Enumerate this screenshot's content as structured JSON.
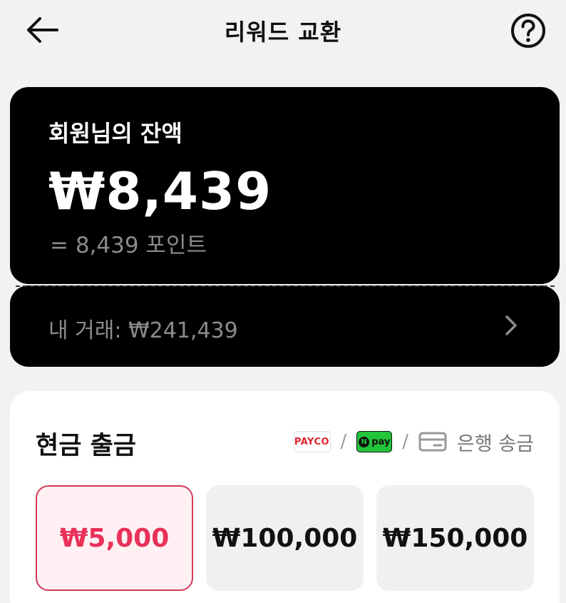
{
  "header": {
    "back_icon": "arrow-left-icon",
    "title": "리워드 교환",
    "help_icon": "question-circle-icon"
  },
  "balance": {
    "label": "회원님의 잔액",
    "amount": "₩8,439",
    "points": "= 8,439 포인트"
  },
  "transactions": {
    "text": "내 거래: ₩241,439",
    "chevron_icon": "chevron-right-icon"
  },
  "cash": {
    "title": "현금 출금",
    "methods": {
      "payco": "PAYCO",
      "separator": "/",
      "npay_n": "N",
      "npay_text": "pay",
      "bank_icon": "card-icon",
      "bank_text": "은행 송금"
    },
    "amounts": [
      {
        "label": "₩5,000",
        "selected": true
      },
      {
        "label": "₩100,000",
        "selected": false
      },
      {
        "label": "₩150,000",
        "selected": false
      }
    ]
  },
  "colors": {
    "accent": "#e8325a",
    "card_bg": "#000000",
    "page_bg": "#f2f2f2",
    "npay_green": "#22c43a",
    "payco_red": "#e0242e"
  }
}
